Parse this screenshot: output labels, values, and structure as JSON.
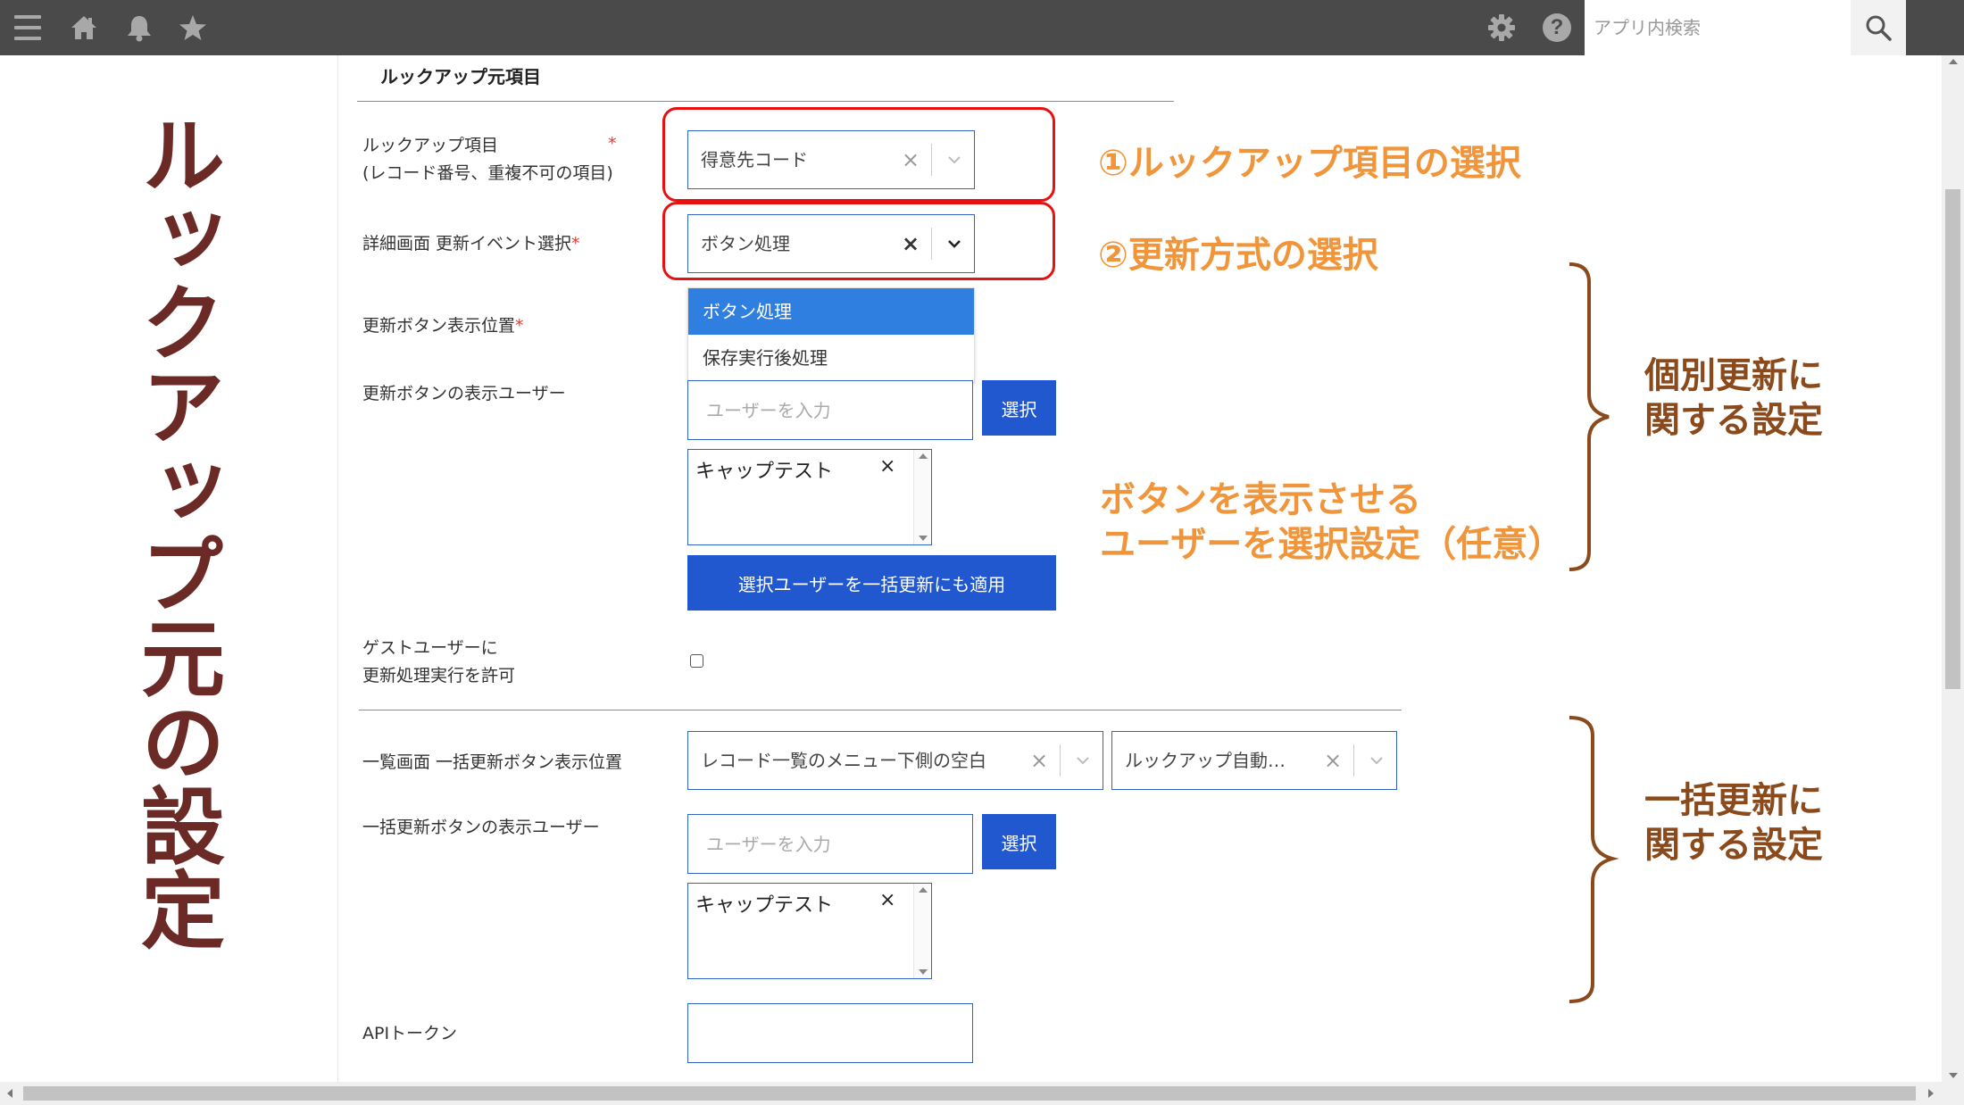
{
  "topbar": {
    "search": {
      "placeholder": "アプリ内検索"
    },
    "icons": [
      "menu-icon",
      "home-icon",
      "bell-icon",
      "star-icon",
      "gear-icon",
      "help-icon",
      "search-icon"
    ]
  },
  "left_panel": {
    "title": "ルックアップ元の設定"
  },
  "form": {
    "section_title": "ルックアップ元項目",
    "lookup_field": {
      "label_line1": "ルックアップ項目",
      "label_line2": "(レコード番号、重複不可の項目)",
      "required_mark": "*",
      "value": "得意先コード",
      "clear": "×"
    },
    "update_event": {
      "label": "詳細画面 更新イベント選択",
      "required_mark": "*",
      "value": "ボタン処理",
      "clear": "×",
      "options": [
        "ボタン処理",
        "保存実行後処理"
      ]
    },
    "button_position": {
      "label": "更新ボタン表示位置",
      "required_mark": "*"
    },
    "button_users": {
      "label": "更新ボタンの表示ユーザー",
      "placeholder": "ユーザーを入力",
      "select_button": "選択",
      "selected_user": "キャップテスト",
      "remove": "×",
      "apply_button": "選択ユーザーを一括更新にも適用"
    },
    "guest": {
      "label_line1": "ゲストユーザーに",
      "label_line2": "更新処理実行を許可"
    },
    "bulk_position": {
      "label": "一覧画面 一括更新ボタン表示位置",
      "value1": "レコード一覧のメニュー下側の空白",
      "value2": "ルックアップ自動…",
      "clear": "×"
    },
    "bulk_users": {
      "label": "一括更新ボタンの表示ユーザー",
      "placeholder": "ユーザーを入力",
      "select_button": "選択",
      "selected_user": "キャップテスト",
      "remove": "×"
    },
    "api_token": {
      "label": "APIトークン"
    }
  },
  "annotations": {
    "step1": "①ルックアップ項目の選択",
    "step2": "②更新方式の選択",
    "users_line1": "ボタンを表示させる",
    "users_line2": "ユーザーを選択設定（任意）",
    "individual_line1": "個別更新に",
    "individual_line2": "関する設定",
    "bulk_line1": "一括更新に",
    "bulk_line2": "関する設定"
  },
  "colors": {
    "accent": "#2158cf",
    "annotation_orange": "#f0953a",
    "annotation_brown": "#8a4a1b",
    "title_brown": "#6b2a26",
    "highlight_red": "#e81010"
  }
}
